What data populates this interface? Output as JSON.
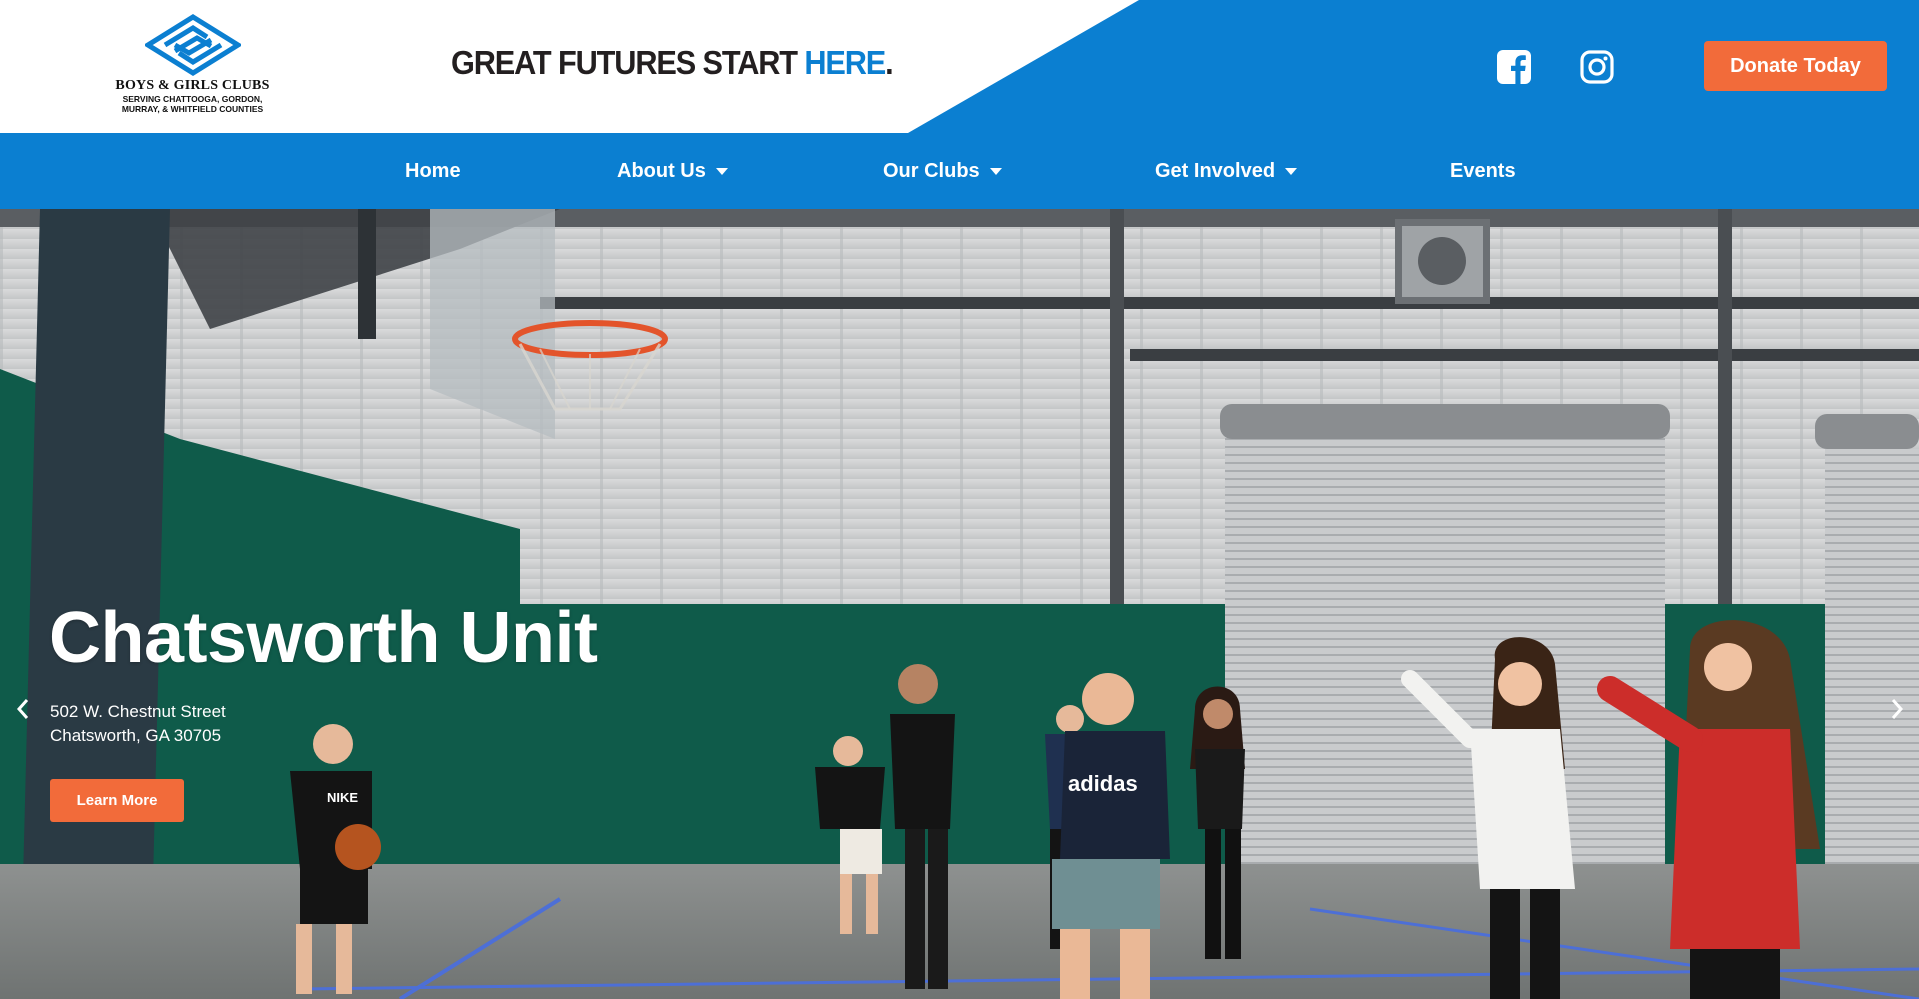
{
  "header": {
    "logo": {
      "name": "BOYS & GIRLS CLUBS",
      "subtitle": "SERVING CHATTOOGA, GORDON,\nMURRAY, & WHITFIELD COUNTIES"
    },
    "tagline": {
      "main": "GREAT FUTURES START ",
      "accent": "HERE",
      "end": "."
    },
    "social": [
      {
        "icon": "facebook-icon"
      },
      {
        "icon": "instagram-icon"
      }
    ],
    "donate_label": "Donate Today"
  },
  "nav": {
    "items": [
      {
        "label": "Home",
        "dropdown": false
      },
      {
        "label": "About Us",
        "dropdown": true
      },
      {
        "label": "Our Clubs",
        "dropdown": true
      },
      {
        "label": "Get Involved",
        "dropdown": true
      },
      {
        "label": "Events",
        "dropdown": false
      }
    ]
  },
  "hero": {
    "title": "Chatsworth Unit",
    "address_line1": "502 W. Chestnut Street",
    "address_line2": "Chatsworth, GA 30705",
    "button_label": "Learn More",
    "shirt_text_1": "NIKE",
    "shirt_text_2": "adidas"
  },
  "colors": {
    "brand_blue": "#0b7fd1",
    "accent_orange": "#f26b3a",
    "court_green": "#0f5b4a"
  }
}
